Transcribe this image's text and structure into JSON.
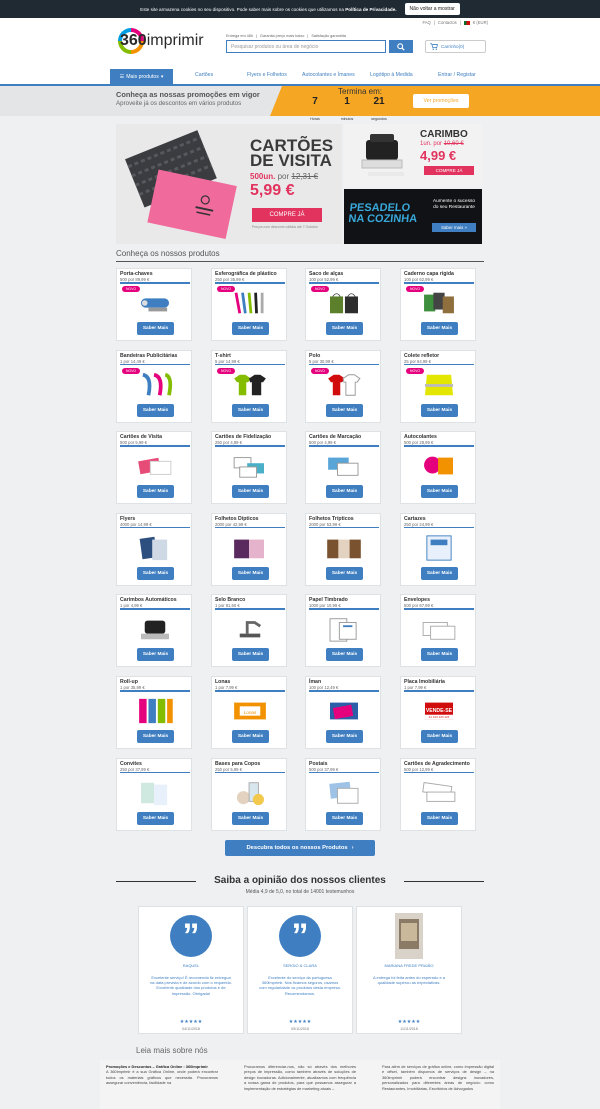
{
  "cookie": {
    "text": "Este site armazena cookies no seu dispositivo. Pode saber mais sobre os cookies que utilizamos na",
    "policy": "Política de Privacidade.",
    "button": "Não voltar a mostrar"
  },
  "toplinks": {
    "faq": "FAQ",
    "contactos": "Contactos",
    "currency": "€ (EUR)"
  },
  "logo": {
    "num": "360",
    "word": "imprimir"
  },
  "hlinks": [
    "Entrega em 48h",
    "Garantia preço mais baixo",
    "Satisfação garantida"
  ],
  "search": {
    "placeholder": "Pesquisar produtos ou área de negócio"
  },
  "cart": {
    "label": "Carrinho(0)"
  },
  "nav": {
    "more": "Mais produtos",
    "items": [
      "Cartões",
      "Flyers e Folhetos",
      "Autocolantes e Ímanes",
      "Logótipo à Medida"
    ],
    "login": "Entrar / Registar"
  },
  "promo": {
    "line1": "Conheça as nossas promoções em vigor",
    "line2": "Aproveite já os descontos em vários produtos",
    "ends": "Termina em:",
    "hours": "7",
    "hours_l": "Horas",
    "minutes": "1",
    "minutes_l": "minutos",
    "seconds": "21",
    "seconds_l": "segundos",
    "button": "Ver promoções"
  },
  "hero": {
    "title1": "CARTÕES",
    "title2": "DE VISITA",
    "qty": "500un.",
    "por": "por",
    "old": "12,31 €",
    "price": "5,99 €",
    "button": "COMPRE JÁ",
    "small": "Preços com desconto válidos até 7 Outubro"
  },
  "side1": {
    "title": "CARIMBO",
    "qty": "1un.",
    "por": "por",
    "old": "10,60 €",
    "price": "4,99 €",
    "button": "COMPRE JÁ"
  },
  "side2": {
    "title1": "PESADELO",
    "title2": "NA COZINHA",
    "text": "Aumente o sucesso do seu Restaurante",
    "button": "Saber mais »"
  },
  "section_title": "Conheça os nossos produtos",
  "products": [
    {
      "name": "Porta-chaves",
      "price": "500 por 89,99 €",
      "novo": true
    },
    {
      "name": "Esferográfica de plástico",
      "price": "250 por 35,99 €",
      "novo": true
    },
    {
      "name": "Saco de alças",
      "price": "100 por 52,99 €",
      "novo": true
    },
    {
      "name": "Caderno capa rígida",
      "price": "100 por 62,99 €",
      "novo": true
    },
    {
      "name": "Bandeiras Publicitárias",
      "price": "1 por 14,49 €",
      "novo": true
    },
    {
      "name": "T-shirt",
      "price": "5 por 14,99 €",
      "novo": true
    },
    {
      "name": "Polo",
      "price": "5 por 30,99 €",
      "novo": true
    },
    {
      "name": "Colete refletor",
      "price": "25 por 64,99 €",
      "novo": true
    },
    {
      "name": "Cartões de Visita",
      "price": "500 por 5,99 €",
      "novo": false
    },
    {
      "name": "Cartões de Fidelização",
      "price": "250 por 4,99 €",
      "novo": false
    },
    {
      "name": "Cartões de Marcação",
      "price": "500 por 4,99 €",
      "novo": false
    },
    {
      "name": "Autocolantes",
      "price": "500 por 28,99 €",
      "novo": false
    },
    {
      "name": "Flyers",
      "price": "4000 por 14,99 €",
      "novo": false
    },
    {
      "name": "Folhetos Dípticos",
      "price": "2000 por 42,99 €",
      "novo": false
    },
    {
      "name": "Folhetos Trípticos",
      "price": "2000 por 53,99 €",
      "novo": false
    },
    {
      "name": "Cartazes",
      "price": "250 por 24,99 €",
      "novo": false
    },
    {
      "name": "Carimbos Automáticos",
      "price": "1 por 4,99 €",
      "novo": false
    },
    {
      "name": "Selo Branco",
      "price": "1 por 81,50 €",
      "novo": false
    },
    {
      "name": "Papel Timbrado",
      "price": "1000 por 10,99 €",
      "novo": false
    },
    {
      "name": "Envelopes",
      "price": "500 por 67,99 €",
      "novo": false
    },
    {
      "name": "Roll-up",
      "price": "1 por 35,99 €",
      "novo": false
    },
    {
      "name": "Lonas",
      "price": "1 por 7,99 €",
      "novo": false
    },
    {
      "name": "Íman",
      "price": "100 por 12,49 €",
      "novo": false
    },
    {
      "name": "Placa Imobiliária",
      "price": "1 por 7,99 €",
      "novo": false
    },
    {
      "name": "Convites",
      "price": "250 por 37,99 €",
      "novo": false
    },
    {
      "name": "Bases para Copos",
      "price": "250 por 5,99 €",
      "novo": false
    },
    {
      "name": "Postais",
      "price": "500 por 37,99 €",
      "novo": false
    },
    {
      "name": "Cartões de Agradecimento",
      "price": "500 por 12,99 €",
      "novo": false
    }
  ],
  "labels": {
    "novo": "NOVO",
    "saber": "Saber Mais",
    "vende": "VENDE-SE",
    "vende_tel": "21 123 123 123",
    "lonas": "Lonas"
  },
  "all_products": "Descubra todos os nossos Produtos",
  "opinion": {
    "title": "Saiba a opinião dos nossos clientes",
    "sub": "Média 4,9 de 5,0, no total de 14001 testemunhos"
  },
  "reviews": [
    {
      "name": "RAQUEL",
      "text": "Excelente serviço! É recomenda fiz entregua na data prevista e de acordo com o requerido. Excelente qualidade dos produtos e de impressão. Obrigada!",
      "stars": "★★★★★",
      "date": "04/11/2018"
    },
    {
      "name": "SERGIO & CLARA",
      "text": "Excelente do serviço da portuguesa 360imprimir. Nós ficamos seguros, usamos com regularidade os produtos desta empresa. Recomendamos.",
      "stars": "★★★★★",
      "date": "05/11/2018"
    },
    {
      "name": "MARIANA FREDE PRAIÃO",
      "text": "A entrega foi feita antes do esperado e a qualidade superou as expectativas.",
      "stars": "★★★★★",
      "date": "11/11/2018"
    }
  ],
  "leia": "Leia mais sobre nós",
  "about": {
    "c1_title": "Promoções e Descontos – Gráfica Online : 360imprimir",
    "c1": "A 360imprimir é a sua Gráfica Online, onde poderá encontrar todos os materiais gráficos que necessita. Procuramos assegurar conveniência, facilidade na",
    "c2": "Procuramos diferenciar-nos, não só através dos melhores preços de impressão, como também através de soluções de design inovadoras. Adicionalmente, atualizamos com frequência a nossa gama de produtos, para que possamos assegurar a implementação de estratégias de marketing atuais –",
    "c3": "Para além de serviços de gráfica online, como impressão digital e offset, também dispomos de serviços de design – na 360imprimir poderá encontrar designs inovadores, personalizados para diferentes áreas de negócio: como Restaurantes, Imobiliárias, Escritórios de Advogados"
  },
  "colors": {
    "blue": "#3f7fc1",
    "pink": "#e1335e",
    "orange": "#f5a623"
  }
}
